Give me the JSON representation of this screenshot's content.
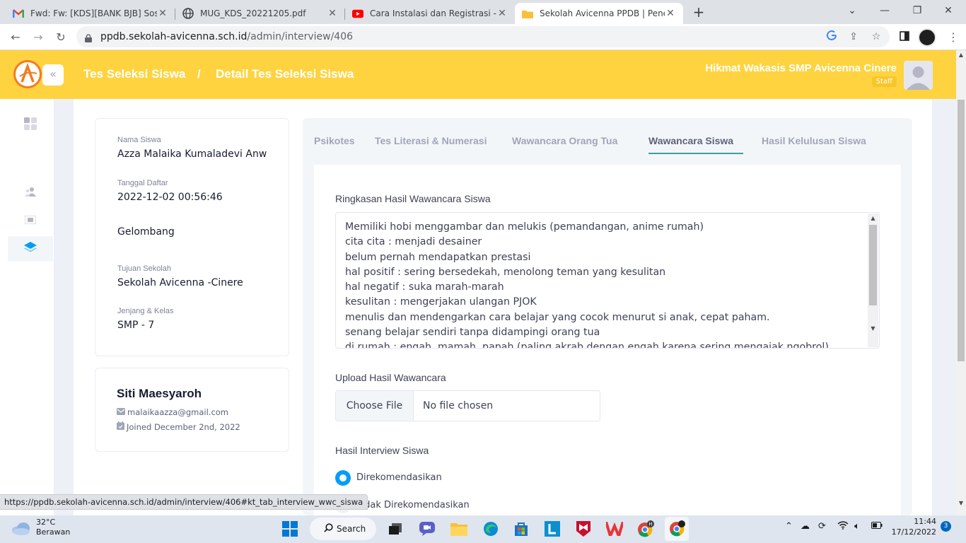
{
  "browser": {
    "tabs": [
      {
        "title": "Fwd: Fw: [KDS][BANK BJB] Sosiali",
        "icon": "gmail-icon"
      },
      {
        "title": "MUG_KDS_20221205.pdf",
        "icon": "globe-icon"
      },
      {
        "title": "Cara Instalasi dan Registrasi - You",
        "icon": "youtube-icon"
      },
      {
        "title": "Sekolah Avicenna PPDB | Penerim",
        "icon": "folder-icon"
      }
    ],
    "active_tab": 3,
    "url_host": "ppdb.sekolah-avicenna.sch.id",
    "url_path": "/admin/interview/406",
    "status_url": "https://ppdb.sekolah-avicenna.sch.id/admin/interview/406#kt_tab_interview_wwc_siswa"
  },
  "header": {
    "breadcrumb_1": "Tes Seleksi Siswa",
    "breadcrumb_sep": "/",
    "breadcrumb_2": "Detail Tes Seleksi Siswa",
    "user_name": "Hikmat Wakasis SMP Avicenna Cinere",
    "user_role": "Staff",
    "brand_color": "#ffd340"
  },
  "student": {
    "name_label": "Nama Siswa",
    "name": "Azza Malaika Kumaladevi Anwar",
    "reg_date_label": "Tanggal Daftar",
    "reg_date": "2022-12-02 00:56:46",
    "wave_label": "Gelombang",
    "school_label": "Tujuan Sekolah",
    "school": "Sekolah Avicenna -Cinere",
    "level_label": "Jenjang & Kelas",
    "level": "SMP - 7"
  },
  "parent": {
    "name": "Siti Maesyaroh",
    "email": "malaikaazza@gmail.com",
    "joined": "Joined December 2nd, 2022"
  },
  "tabs": [
    "Psikotes",
    "Tes Literasi & Numerasi",
    "Wawancara Orang Tua",
    "Wawancara Siswa",
    "Hasil Kelulusan Siswa"
  ],
  "active_tab": 3,
  "form": {
    "summary_label": "Ringkasan Hasil Wawancara Siswa",
    "summary_lines": [
      "Memiliki hobi menggambar dan melukis (pemandangan, anime rumah)",
      "cita cita : menjadi desainer",
      "belum pernah mendapatkan prestasi",
      "hal positif : sering bersedekah, menolong teman yang kesulitan",
      "hal negatif : suka marah-marah",
      "kesulitan : mengerjakan ulangan PJOK",
      "menulis dan mendengarkan cara belajar yang cocok menurut si anak, cepat paham.",
      "senang belajar sendiri tanpa didampingi orang tua",
      "di rumah : engah, mamah, papah (paling akrab dengan engah karena sering mengajak ngobrol)"
    ],
    "upload_label": "Upload Hasil Wawancara",
    "choose_file": "Choose File",
    "no_file": "No file chosen",
    "result_label": "Hasil Interview Siswa",
    "options": [
      "Direkomendasikan",
      "Tidak Direkomendasikan"
    ],
    "selected_option": 0,
    "accent_color": "#009ef7"
  },
  "taskbar": {
    "temp": "32°C",
    "weather": "Berawan",
    "search": "Search",
    "time": "11:44",
    "date": "17/12/2022",
    "notifications": "3"
  }
}
